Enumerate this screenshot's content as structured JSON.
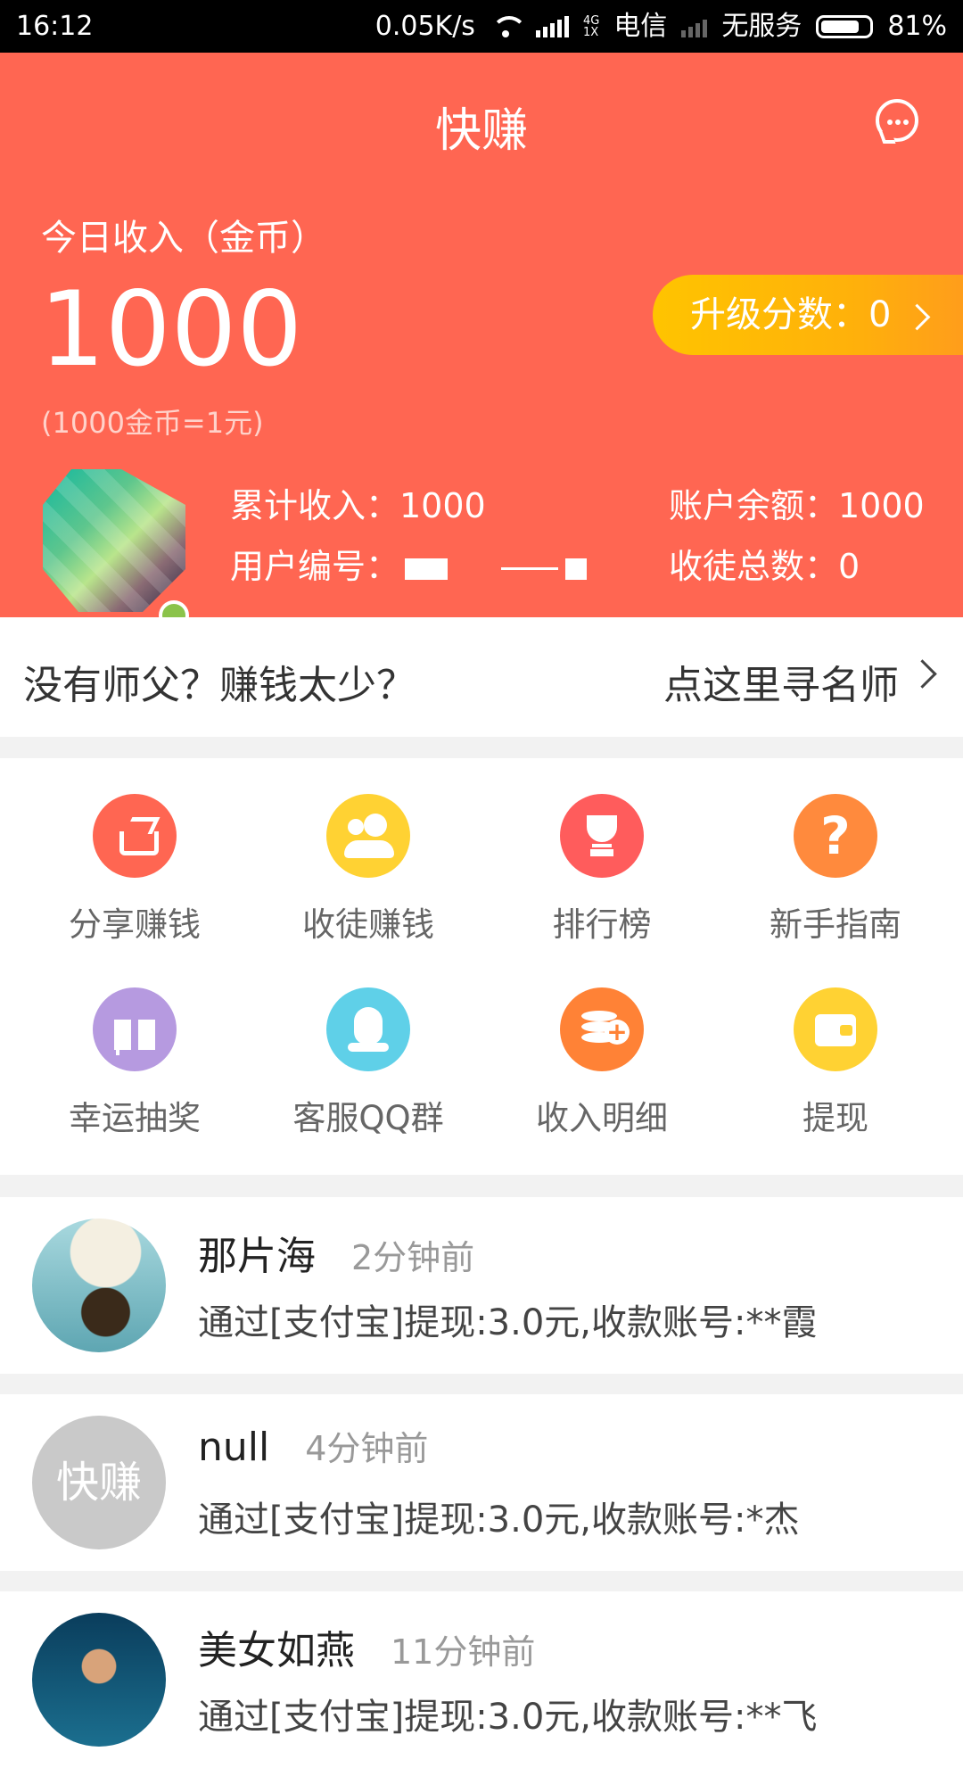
{
  "status_bar": {
    "time": "16:12",
    "net_speed": "0.05K/s",
    "network_type_top": "4G",
    "network_type_bottom": "1X",
    "carrier1": "电信",
    "carrier2": "无服务",
    "battery": "81%",
    "battery_level": 0.81
  },
  "header": {
    "title": "快赚",
    "chat_icon": "chat-bubble-icon",
    "today_label": "今日收入（金币）",
    "today_amount": "1000",
    "rate_note": "(1000金币=1元)",
    "upgrade_label": "升级分数：0",
    "total_income": "累计收入：1000",
    "balance": "账户余额：1000",
    "user_id_label": "用户编号：",
    "user_id_value": "",
    "apprentices": "收徒总数：0"
  },
  "mentor_bar": {
    "left_text": "没有师父？赚钱太少？",
    "right_text": "点这里寻名师"
  },
  "grid": {
    "items": [
      {
        "label": "分享赚钱",
        "icon": "share-icon",
        "color": "#ff6652"
      },
      {
        "label": "收徒赚钱",
        "icon": "people-icon",
        "color": "#ffd233"
      },
      {
        "label": "排行榜",
        "icon": "trophy-icon",
        "color": "#ff5c5c"
      },
      {
        "label": "新手指南",
        "icon": "question-icon",
        "color": "#ff8a3d"
      },
      {
        "label": "幸运抽奖",
        "icon": "gift-icon",
        "color": "#b69ae0"
      },
      {
        "label": "客服QQ群",
        "icon": "qq-icon",
        "color": "#5fd0e8"
      },
      {
        "label": "收入明细",
        "icon": "coins-icon",
        "color": "#ff8236"
      },
      {
        "label": "提现",
        "icon": "wallet-icon",
        "color": "#ffd233"
      }
    ]
  },
  "feed": [
    {
      "name": "那片海",
      "time": "2分钟前",
      "text": "通过[支付宝]提现:3.0元,收款账号:**霞"
    },
    {
      "name": "null",
      "time": "4分钟前",
      "text": "通过[支付宝]提现:3.0元,收款账号:*杰",
      "avatar_text": "快赚"
    },
    {
      "name": "美女如燕",
      "time": "11分钟前",
      "text": "通过[支付宝]提现:3.0元,收款账号:**飞"
    }
  ]
}
